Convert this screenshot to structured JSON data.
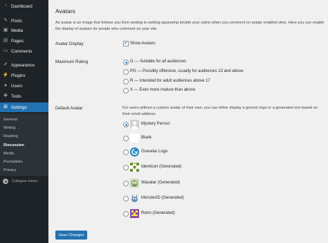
{
  "sidebar": {
    "items": [
      {
        "label": "Dashboard",
        "icon": "dashboard-icon"
      },
      {
        "label": "Posts",
        "icon": "pin-icon"
      },
      {
        "label": "Media",
        "icon": "media-icon"
      },
      {
        "label": "Pages",
        "icon": "page-icon"
      },
      {
        "label": "Comments",
        "icon": "comment-icon"
      },
      {
        "label": "Appearance",
        "icon": "brush-icon"
      },
      {
        "label": "Plugins",
        "icon": "plug-icon"
      },
      {
        "label": "Users",
        "icon": "user-icon"
      },
      {
        "label": "Tools",
        "icon": "wrench-icon"
      },
      {
        "label": "Settings",
        "icon": "settings-icon",
        "active": true
      }
    ],
    "submenu": [
      "General",
      "Writing",
      "Reading",
      "Discussion",
      "Media",
      "Permalinks",
      "Privacy"
    ],
    "submenu_current": "Discussion",
    "collapse_label": "Collapse menu"
  },
  "main": {
    "heading": "Avatars",
    "description": "An avatar is an image that follows you from weblog to weblog appearing beside your name when you comment on avatar enabled sites. Here you can enable the display of avatars for people who comment on your site.",
    "avatar_display": {
      "label": "Avatar Display",
      "checkbox_label": "Show Avatars",
      "checked": true
    },
    "max_rating": {
      "label": "Maximum Rating",
      "options": [
        {
          "label": "G — Suitable for all audiences",
          "checked": true
        },
        {
          "label": "PG — Possibly offensive, usually for audiences 13 and above",
          "checked": false
        },
        {
          "label": "R — Intended for adult audiences above 17",
          "checked": false
        },
        {
          "label": "X — Even more mature than above",
          "checked": false
        }
      ]
    },
    "default_avatar": {
      "label": "Default Avatar",
      "description": "For users without a custom avatar of their own, you can either display a generic logo or a generated one based on their email address.",
      "options": [
        {
          "label": "Mystery Person",
          "checked": true
        },
        {
          "label": "Blank",
          "checked": false
        },
        {
          "label": "Gravatar Logo",
          "checked": false
        },
        {
          "label": "Identicon (Generated)",
          "checked": false
        },
        {
          "label": "Wavatar (Generated)",
          "checked": false
        },
        {
          "label": "MonsterID (Generated)",
          "checked": false
        },
        {
          "label": "Retro (Generated)",
          "checked": false
        }
      ]
    },
    "save_label": "Save Changes"
  },
  "colors": {
    "accent": "#2271b1",
    "sidebar_bg": "#1d2327",
    "page_bg": "#f0f0f1"
  }
}
